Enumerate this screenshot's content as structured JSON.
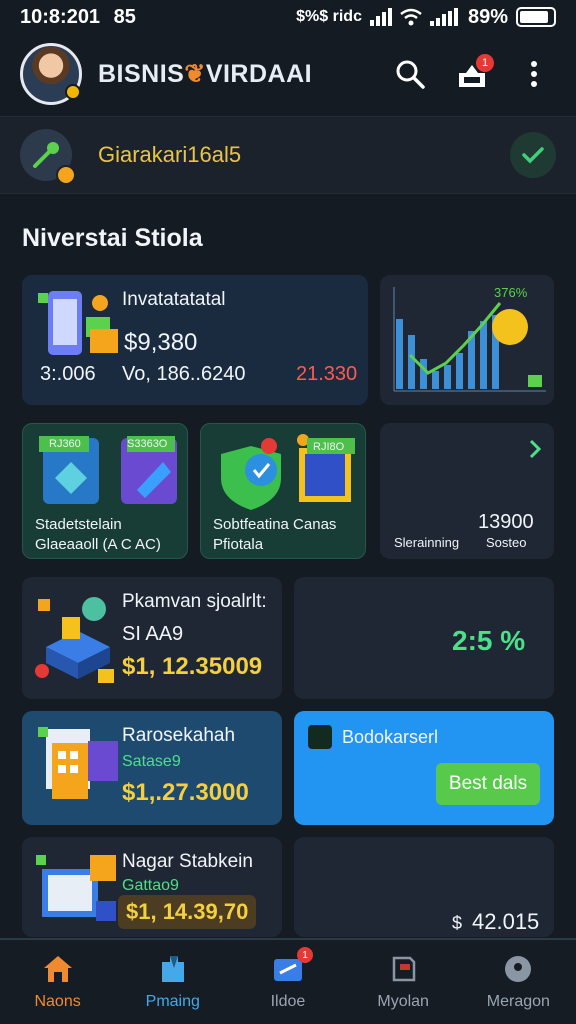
{
  "status_bar": {
    "time": "10:8:201",
    "carrier": "85",
    "network_text": "$%$ ridc",
    "battery_text": "89%",
    "battery_level": 0.89
  },
  "header": {
    "brand": "BISNIS❤VIRDAAI",
    "brand_text": "BISNIS",
    "brand_text2": "VIRDAAI",
    "notification_count": "1"
  },
  "promo": {
    "text": "Giarakari16al5"
  },
  "section": {
    "title": "Niverstai Stiola"
  },
  "cards": {
    "investment": {
      "title": "Invatatatatal",
      "amount": "$9,380",
      "left_value": "3:.006",
      "mid_value": "Vo, 186..6240",
      "right_value": "21.330"
    },
    "chart": {
      "label": "376%"
    },
    "stats1": {
      "badge1": "RJ360",
      "badge2": "S3363O",
      "line1": "Stadetstelain",
      "line2": "Glaeaaoll (A C AC)"
    },
    "stats2": {
      "badge": "RJI8O",
      "line1": "Sobtfeatina Canas",
      "line2": "Pfiotala"
    },
    "stats3": {
      "value": "13900",
      "label_left": "Slerainning",
      "label_right": "Sosteo"
    },
    "payment": {
      "title": "Pkamvan sjoalrlt:",
      "sub": "SI AA9",
      "amount": "$1, 12.35009"
    },
    "percent": {
      "value": "2:5 %"
    },
    "wallet": {
      "title": "Rarosekahah",
      "sub": "Satase9",
      "amount": "$1,.27.3000"
    },
    "promo_card": {
      "title": "Bodokarserl",
      "button": "Best dals"
    },
    "account": {
      "title": "Nagar Stabkein",
      "sub": "Gattao9",
      "amount": "$1, 14.39,70"
    },
    "total": {
      "prefix": "$",
      "value": "42.015"
    }
  },
  "nav": [
    {
      "label": "Naons",
      "icon": "home-icon"
    },
    {
      "label": "Pmaing",
      "icon": "bookmark-icon"
    },
    {
      "label": "Ildoe",
      "icon": "ticket-icon",
      "badge": "1"
    },
    {
      "label": "Myolan",
      "icon": "document-icon"
    },
    {
      "label": "Meragon",
      "icon": "profile-icon"
    }
  ],
  "colors": {
    "accent": "#f08a2e",
    "positive": "#4be08a",
    "gold": "#f4d03f",
    "bright_card": "#2295f2"
  }
}
